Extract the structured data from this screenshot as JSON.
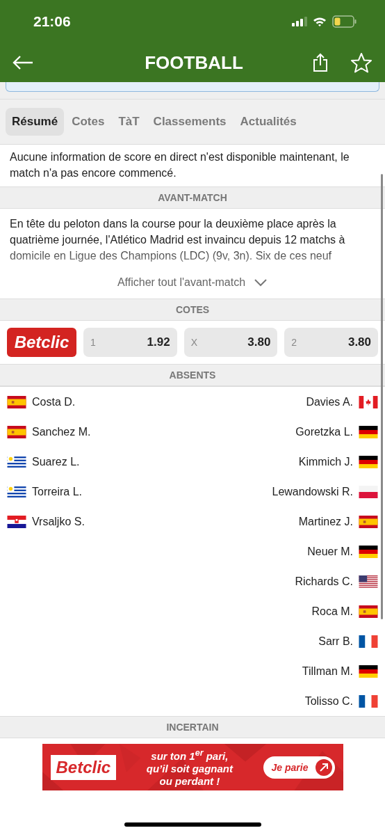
{
  "status_bar": {
    "time": "21:06"
  },
  "header": {
    "title": "FOOTBALL"
  },
  "tabs": [
    {
      "label": "Résumé",
      "selected": true
    },
    {
      "label": "Cotes",
      "selected": false
    },
    {
      "label": "TàT",
      "selected": false
    },
    {
      "label": "Classements",
      "selected": false
    },
    {
      "label": "Actualités",
      "selected": false
    }
  ],
  "live_info": "Aucune information de score en direct n'est disponible maintenant, le match n'a pas encore commencé.",
  "prematch": {
    "heading": "AVANT-MATCH",
    "text": "En tête du peloton dans la course pour la deuxième place après la quatrième journée, l'Atlético Madrid est invaincu depuis 12 matchs à domicile en Ligue des Champions (LDC) (9v, 3n). Six de ces neuf",
    "show_all": "Afficher tout l'avant-match"
  },
  "odds": {
    "heading": "COTES",
    "bookmaker": "Betclic",
    "items": [
      {
        "label": "1",
        "value": "1.92"
      },
      {
        "label": "X",
        "value": "3.80"
      },
      {
        "label": "2",
        "value": "3.80"
      }
    ]
  },
  "absents": {
    "heading": "ABSENTS",
    "home": [
      {
        "name": "Costa D.",
        "kind": "es"
      },
      {
        "name": "Sanchez M.",
        "kind": "es"
      },
      {
        "name": "Suarez L.",
        "kind": "uy"
      },
      {
        "name": "Torreira L.",
        "kind": "uy"
      },
      {
        "name": "Vrsaljko S.",
        "kind": "hr"
      }
    ],
    "away": [
      {
        "name": "Davies A.",
        "kind": "ca"
      },
      {
        "name": "Goretzka L.",
        "kind": "de"
      },
      {
        "name": "Kimmich J.",
        "kind": "de"
      },
      {
        "name": "Lewandowski R.",
        "kind": "pl"
      },
      {
        "name": "Martinez J.",
        "kind": "es"
      },
      {
        "name": "Neuer M.",
        "kind": "de"
      },
      {
        "name": "Richards C.",
        "kind": "us"
      },
      {
        "name": "Roca M.",
        "kind": "es"
      },
      {
        "name": "Sarr B.",
        "kind": "fr"
      },
      {
        "name": "Tillman M.",
        "kind": "de"
      },
      {
        "name": "Tolisso C.",
        "kind": "fr"
      }
    ]
  },
  "uncertain": {
    "heading": "INCERTAIN"
  },
  "ad": {
    "brand": "Betclic",
    "line1": "sur ton 1$^{er}$ pari,",
    "line2": "qu’il soit gagnant",
    "line3": "ou perdant !",
    "cta": "Je parie"
  }
}
